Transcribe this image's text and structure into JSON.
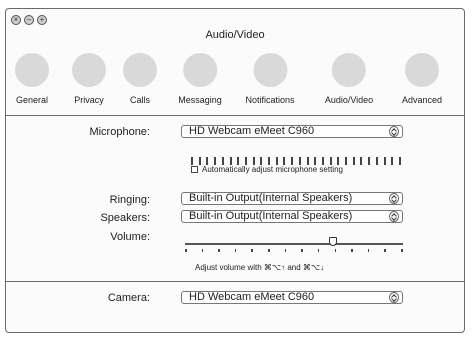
{
  "window": {
    "title": "Audio/Video"
  },
  "window_controls": {
    "close_glyph": "×",
    "minimize_glyph": "–",
    "zoom_glyph": "+"
  },
  "toolbar": {
    "items": [
      {
        "label": "General"
      },
      {
        "label": "Privacy"
      },
      {
        "label": "Calls"
      },
      {
        "label": "Messaging"
      },
      {
        "label": "Notifications"
      },
      {
        "label": "Audio/Video"
      },
      {
        "label": "Advanced"
      }
    ]
  },
  "microphone": {
    "label": "Microphone:",
    "value": "HD Webcam eMeet C960",
    "auto_adjust_label": "Automatically adjust microphone setting",
    "auto_adjust_checked": false
  },
  "ringing": {
    "label": "Ringing:",
    "value": "Built-in Output(Internal Speakers)"
  },
  "speakers": {
    "label": "Speakers:",
    "value": "Built-in Output(Internal Speakers)"
  },
  "volume": {
    "label": "Volume:",
    "level_fraction": 0.68,
    "hint": "Adjust volume with ⌘⌥↑ and ⌘⌥↓"
  },
  "camera": {
    "label": "Camera:",
    "value": "HD Webcam eMeet C960"
  }
}
